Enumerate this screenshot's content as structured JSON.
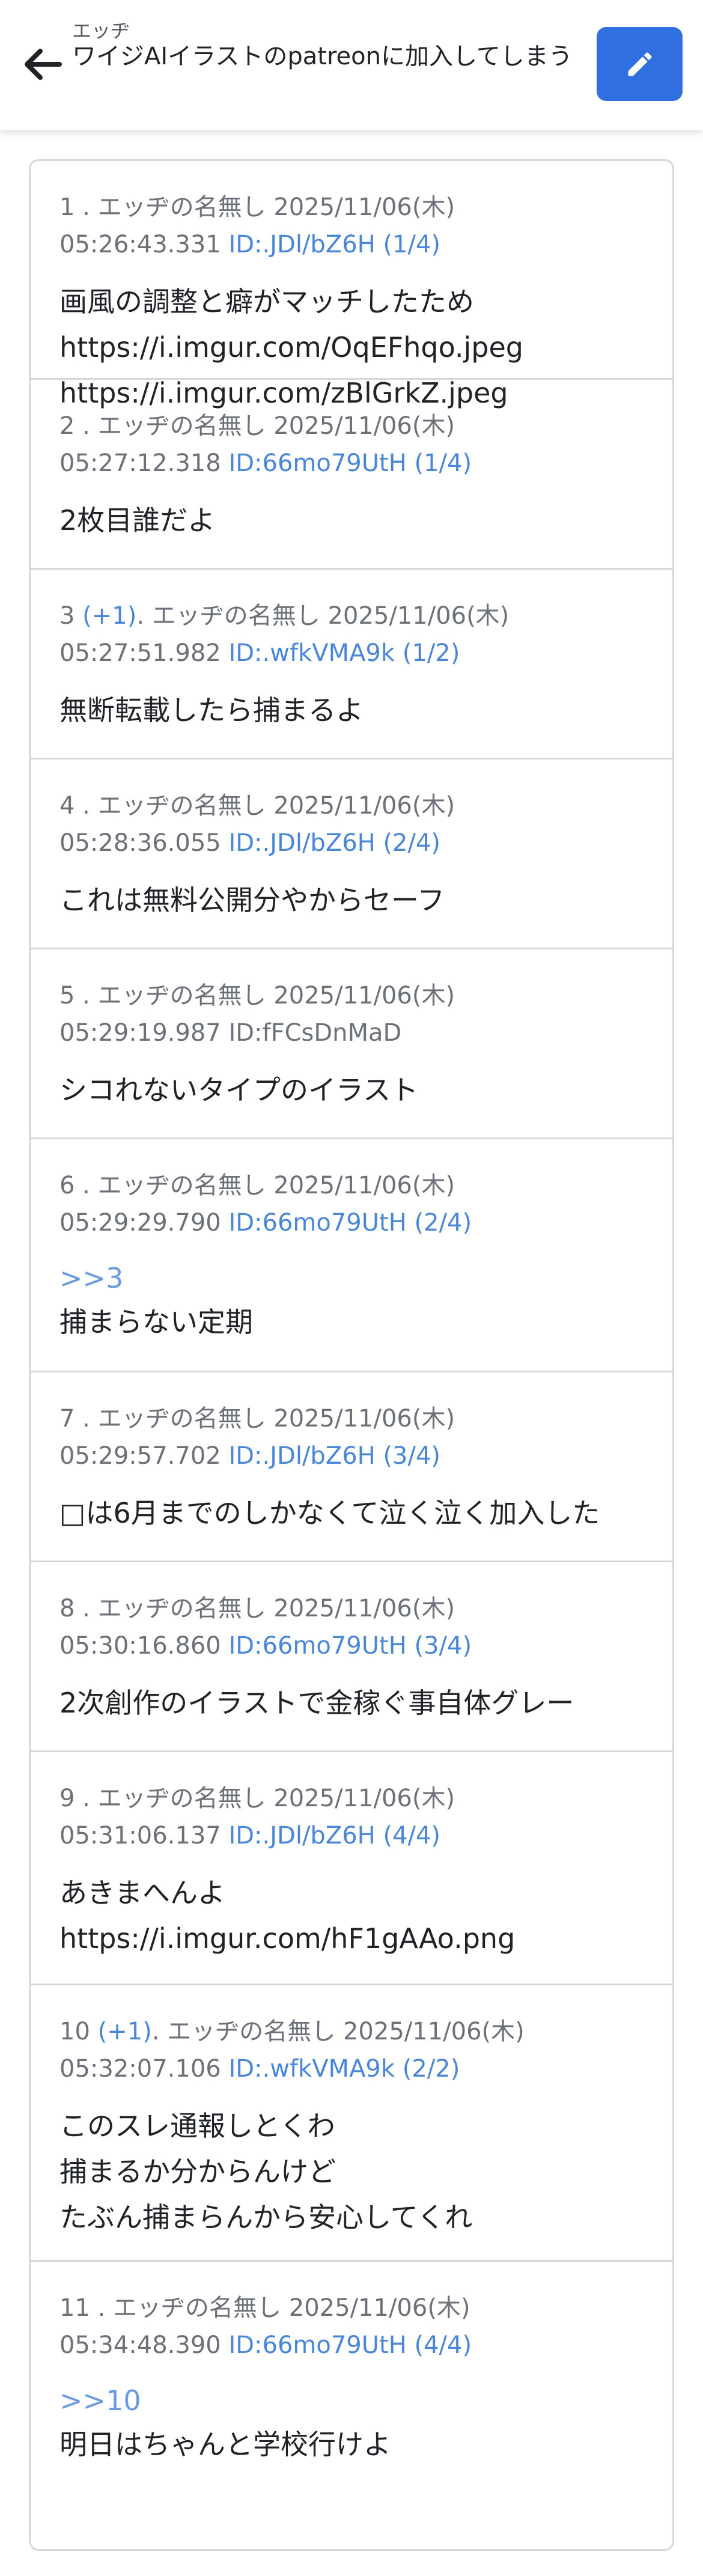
{
  "header": {
    "back_icon": "arrow-left-icon",
    "board_name": "エッヂ",
    "thread_title": "ワイジAIイラストのpatreonに加入してしまう",
    "edit_icon": "pencil-icon"
  },
  "colors": {
    "accent": "#2f6fe0",
    "link": "#4a86d8",
    "meta": "#6b7079",
    "border": "#d4d7db"
  },
  "posts": [
    {
      "number": "1",
      "replies": "",
      "name": "エッヂの名無し",
      "date": "2025/11/06(木)",
      "time": "05:26:43.331",
      "id": "ID:.JDl/bZ6H (1/4)",
      "anchor": "",
      "body": "画風の調整と癖がマッチしたため\nhttps://i.imgur.com/OqEFhqo.jpeg\nhttps://i.imgur.com/zBlGrkZ.jpeg"
    },
    {
      "number": "2",
      "replies": "",
      "name": "エッヂの名無し",
      "date": "2025/11/06(木)",
      "time": "05:27:12.318",
      "id": "ID:66mo79UtH (1/4)",
      "anchor": "",
      "body": "2枚目誰だよ"
    },
    {
      "number": "3",
      "replies": "(+1)",
      "name": "エッヂの名無し",
      "date": "2025/11/06(木)",
      "time": "05:27:51.982",
      "id": "ID:.wfkVMA9k (1/2)",
      "anchor": "",
      "body": "無断転載したら捕まるよ"
    },
    {
      "number": "4",
      "replies": "",
      "name": "エッヂの名無し",
      "date": "2025/11/06(木)",
      "time": "05:28:36.055",
      "id": "ID:.JDl/bZ6H (2/4)",
      "anchor": "",
      "body": "これは無料公開分やからセーフ"
    },
    {
      "number": "5",
      "replies": "",
      "name": "エッヂの名無し",
      "date": "2025/11/06(木)",
      "time": "05:29:19.987",
      "id": "ID:fFCsDnMaD",
      "anchor": "",
      "body": "シコれないタイプのイラスト"
    },
    {
      "number": "6",
      "replies": "",
      "name": "エッヂの名無し",
      "date": "2025/11/06(木)",
      "time": "05:29:29.790",
      "id": "ID:66mo79UtH (2/4)",
      "anchor": ">>3",
      "body": "捕まらない定期"
    },
    {
      "number": "7",
      "replies": "",
      "name": "エッヂの名無し",
      "date": "2025/11/06(木)",
      "time": "05:29:57.702",
      "id": "ID:.JDl/bZ6H (3/4)",
      "anchor": "",
      "body": "□は6月までのしかなくて泣く泣く加入した"
    },
    {
      "number": "8",
      "replies": "",
      "name": "エッヂの名無し",
      "date": "2025/11/06(木)",
      "time": "05:30:16.860",
      "id": "ID:66mo79UtH (3/4)",
      "anchor": "",
      "body": "2次創作のイラストで金稼ぐ事自体グレー"
    },
    {
      "number": "9",
      "replies": "",
      "name": "エッヂの名無し",
      "date": "2025/11/06(木)",
      "time": "05:31:06.137",
      "id": "ID:.JDl/bZ6H (4/4)",
      "anchor": "",
      "body": "あきまへんよ\nhttps://i.imgur.com/hF1gAAo.png"
    },
    {
      "number": "10",
      "replies": "(+1)",
      "name": "エッヂの名無し",
      "date": "2025/11/06(木)",
      "time": "05:32:07.106",
      "id": "ID:.wfkVMA9k (2/2)",
      "anchor": "",
      "body": "このスレ通報しとくわ\n捕まるか分からんけど\nたぶん捕まらんから安心してくれ"
    },
    {
      "number": "11",
      "replies": "",
      "name": "エッヂの名無し",
      "date": "2025/11/06(木)",
      "time": "05:34:48.390",
      "id": "ID:66mo79UtH (4/4)",
      "anchor": ">>10",
      "body": "明日はちゃんと学校行けよ"
    }
  ]
}
